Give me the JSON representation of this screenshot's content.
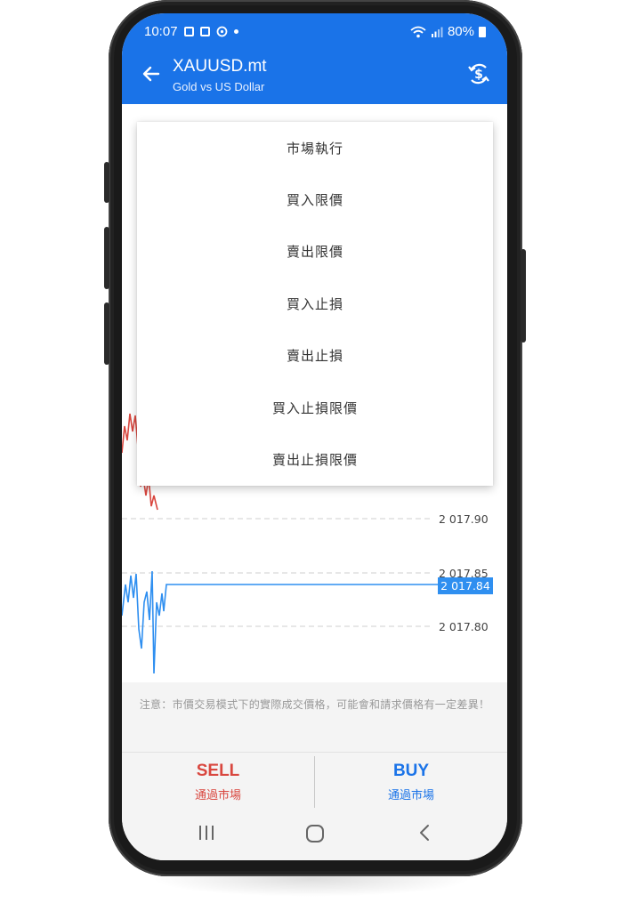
{
  "status_bar": {
    "time": "10:07",
    "battery": "80%",
    "icons": [
      "image-icon",
      "media-icon",
      "sync-icon",
      "dot-icon",
      "wifi-icon",
      "signal-icon",
      "battery-icon"
    ]
  },
  "app_bar": {
    "title": "XAUUSD.mt",
    "subtitle": "Gold vs US Dollar",
    "background": "#1a73e8"
  },
  "order_menu": {
    "items": [
      "市場執行",
      "買入限價",
      "賣出限價",
      "買入止損",
      "賣出止損",
      "買入止損限價",
      "賣出止損限價"
    ]
  },
  "chart": {
    "price_levels": [
      "2 017.90",
      "2 017.85",
      "2 017.80"
    ],
    "current_price": "2 017.84",
    "bid_color": "#2f8ff0",
    "ask_color": "#d9473f"
  },
  "notice": {
    "text": "注意：市價交易模式下的實際成交價格，可能會和請求價格有一定差異！"
  },
  "trade": {
    "sell_label": "SELL",
    "sell_sub": "通過市場",
    "sell_color": "#d9473f",
    "buy_label": "BUY",
    "buy_sub": "通過市場",
    "buy_color": "#1a73e8"
  },
  "nav": {
    "icons": [
      "recents-icon",
      "home-icon",
      "back-icon"
    ]
  }
}
